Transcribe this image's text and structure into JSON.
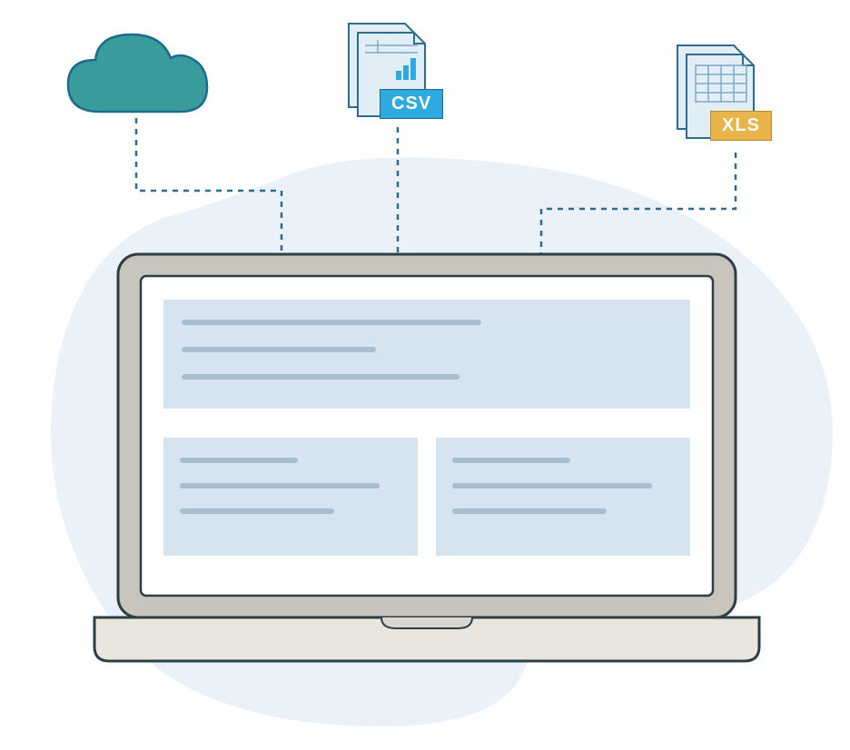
{
  "badges": {
    "csv": "CSV",
    "xls": "XLS"
  },
  "icons": {
    "cloud": "cloud-icon",
    "csv_file": "csv-file-icon",
    "xls_file": "xls-file-icon",
    "laptop": "laptop-icon"
  },
  "colors": {
    "blob": "#EBF1F8",
    "cloud": "#3A9B9B",
    "cloud_stroke": "#1A6B8F",
    "file_bg": "#E1EEF6",
    "file_stroke": "#2D6B8F",
    "csv_badge": "#2EAAE1",
    "xls_badge": "#E9B54A",
    "laptop_bezel": "#C8C6BC",
    "laptop_stroke": "#2C3E46",
    "content_block": "#D6E4EF",
    "content_line": "#A7BECF",
    "connector": "#2D6B8F"
  }
}
